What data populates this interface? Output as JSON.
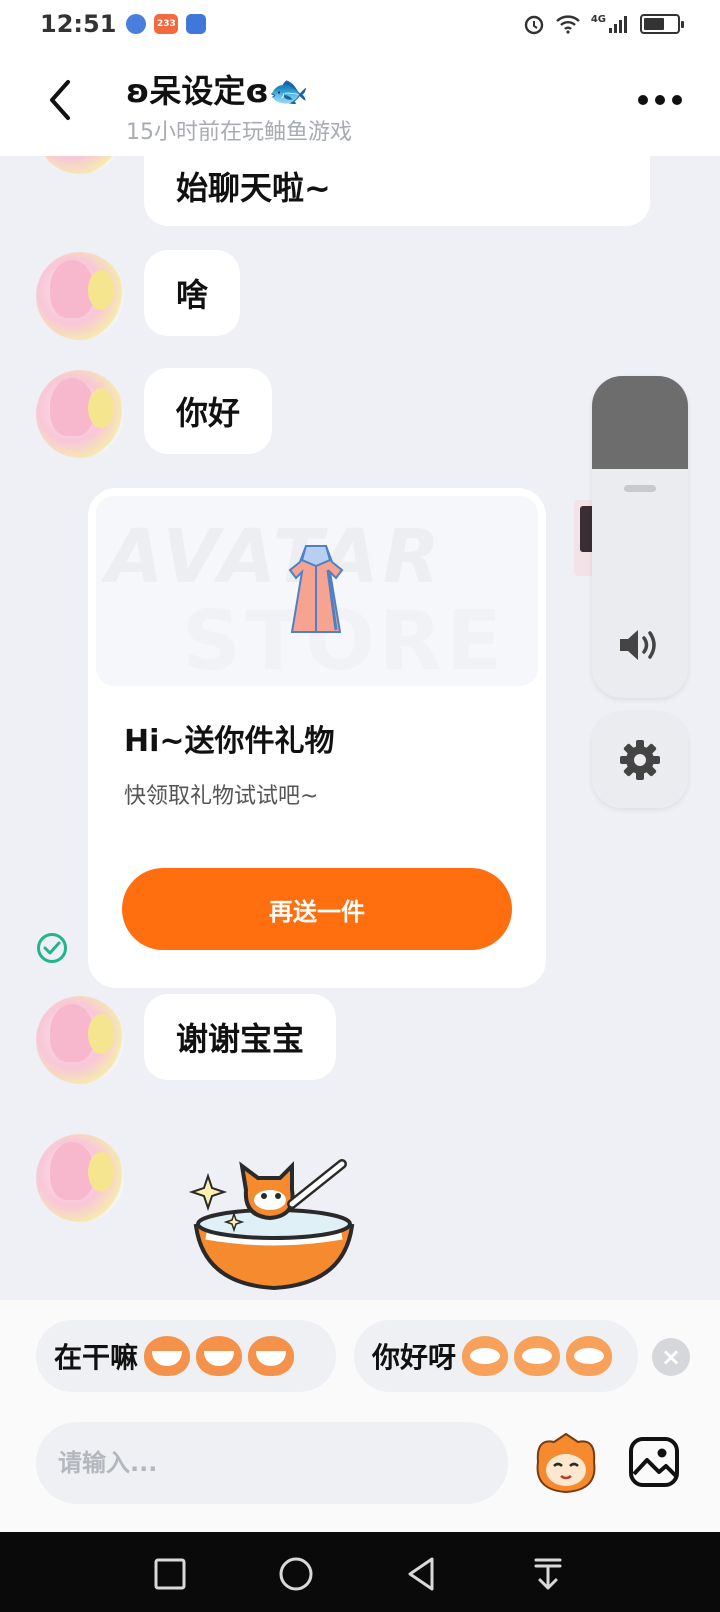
{
  "status_bar": {
    "time": "12:51",
    "badge_233": "233",
    "network_label": "4G"
  },
  "header": {
    "title": "ʚ呆设定ɞ🐟",
    "subtitle": "15小时前在玩鲉鱼游戏"
  },
  "messages": {
    "m1": "始聊天啦~",
    "m2": "啥",
    "m3": "你好",
    "m4": "谢谢宝宝"
  },
  "gift_card": {
    "store_line1": "AVATAR",
    "store_line2": "STORE",
    "title": "Hi~送你件礼物",
    "subtitle": "快领取礼物试试吧~",
    "button_label": "再送一件"
  },
  "volume": {
    "level": 0.29
  },
  "quick_replies": [
    {
      "label": "在干嘛"
    },
    {
      "label": "你好呀"
    }
  ],
  "input": {
    "placeholder": "请输入..."
  },
  "icons": {
    "back": "chevron-left-icon",
    "more": "more-dots-icon",
    "speaker": "speaker-icon",
    "settings": "gear-icon",
    "read_receipt": "check-circle-icon",
    "emoji": "emoji-mascot-icon",
    "image": "image-icon"
  },
  "colors": {
    "accent": "#ff6f0f",
    "background": "#eef0f5",
    "read_receipt": "#21b58a"
  }
}
